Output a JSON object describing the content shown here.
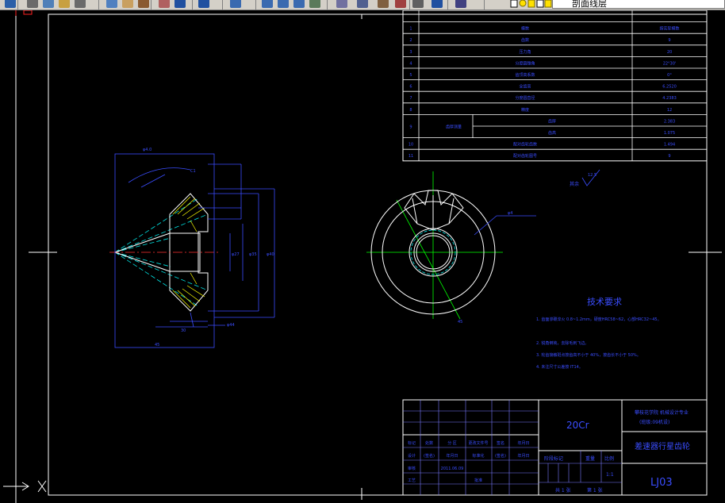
{
  "toolbar": {
    "layer_name": "剖面线层",
    "buttons": [
      "save-icon",
      "print-icon",
      "preview-icon",
      "publish-icon",
      "cut-icon",
      "copy-icon",
      "paste-icon",
      "match-properties-icon",
      "brush-icon",
      "undo-icon",
      "redo-icon",
      "pan-icon",
      "zoom-realtime-icon",
      "zoom-window-icon",
      "zoom-previous-icon",
      "properties-icon",
      "design-center-icon",
      "tool-palettes-icon",
      "sheet-set-icon",
      "markup-icon",
      "calculator-icon",
      "help-icon",
      "layer-manager-icon"
    ]
  },
  "param_table": {
    "rows": [
      {
        "no": "1",
        "name": "模数",
        "value": "按实际模数"
      },
      {
        "no": "2",
        "name": "齿数",
        "value": "9"
      },
      {
        "no": "3",
        "name": "压力角",
        "value": "20"
      },
      {
        "no": "4",
        "name": "分度圆锥角",
        "value": "22°30'"
      },
      {
        "no": "5",
        "name": "齿顶高系数",
        "value": "0°"
      },
      {
        "no": "6",
        "name": "全齿高",
        "value": "6.2520"
      },
      {
        "no": "7",
        "name": "分度圆直径",
        "value": "4.2383"
      },
      {
        "no": "8",
        "name": "精度",
        "value": "12"
      },
      {
        "no": "9a",
        "group": "齿厚测量",
        "name": "齿厚",
        "value": "2.383"
      },
      {
        "no": "9b",
        "group": "",
        "name": "齿高",
        "value": "1.075"
      },
      {
        "no": "10",
        "name": "配对齿轮齿数",
        "value": "1.494"
      },
      {
        "no": "11",
        "name": "配对齿轮图号",
        "value": "9"
      }
    ]
  },
  "notes": {
    "title": "技术要求",
    "items": [
      "1.  齿面渗碳淬火 0.8~1.2mm，硬度HRC58~62，心部HRC32~45。",
      "2.  锐角倒钝，去除毛刺飞边。",
      "3.  轮齿接触斑点按齿高不小于 40%，按齿长不小于 50%。",
      "4.  未注尺寸公差按 IT14。"
    ]
  },
  "roughness": {
    "label": "其余",
    "value": "12.5"
  },
  "dimension_labels": [
    "φ4.0",
    "φ27",
    "φ35",
    "φ40",
    "φ44",
    "C1",
    "30",
    "45",
    "φ4"
  ],
  "title_block": {
    "material": "20Cr",
    "school_line1": "攀枝花学院 机械设计专业",
    "school_line2": "(班级:09机设)",
    "part_name": "差速器行星齿轮",
    "drawing_no": "LJ03",
    "scale_label": "比例",
    "scale_value": "1:1",
    "qty_label": "数量",
    "weight_label": "重量",
    "sheet_label": "共 1 张",
    "sheet_no": "第 1 张",
    "stage_label": "阶段标记",
    "rows": [
      {
        "c1": "标记",
        "c2": "处数",
        "c3": "分 区",
        "c4": "更改文件号",
        "c5": "签名",
        "c6": "年月日"
      },
      {
        "c1": "设计",
        "c2": "(签名)",
        "c3": "年月日",
        "c4": "标准化",
        "c5": "(签名)",
        "c6": "年月日"
      },
      {
        "c1": "审核",
        "c2": "",
        "c3": "2011.06.09",
        "c4": "",
        "c5": "",
        "c6": ""
      },
      {
        "c1": "工艺",
        "c2": "",
        "c3": "",
        "c4": "批准",
        "c5": "",
        "c6": ""
      }
    ]
  },
  "colors": {
    "background": "#000000",
    "frame": "#ffffff",
    "table_text": "#3a4dff",
    "dimension": "#3a4dff",
    "part_outline": "#ffffff",
    "center_line": "#ff3030",
    "hatch": "#ffff00",
    "axis": "#00ff00",
    "construction": "#00e5e5"
  }
}
